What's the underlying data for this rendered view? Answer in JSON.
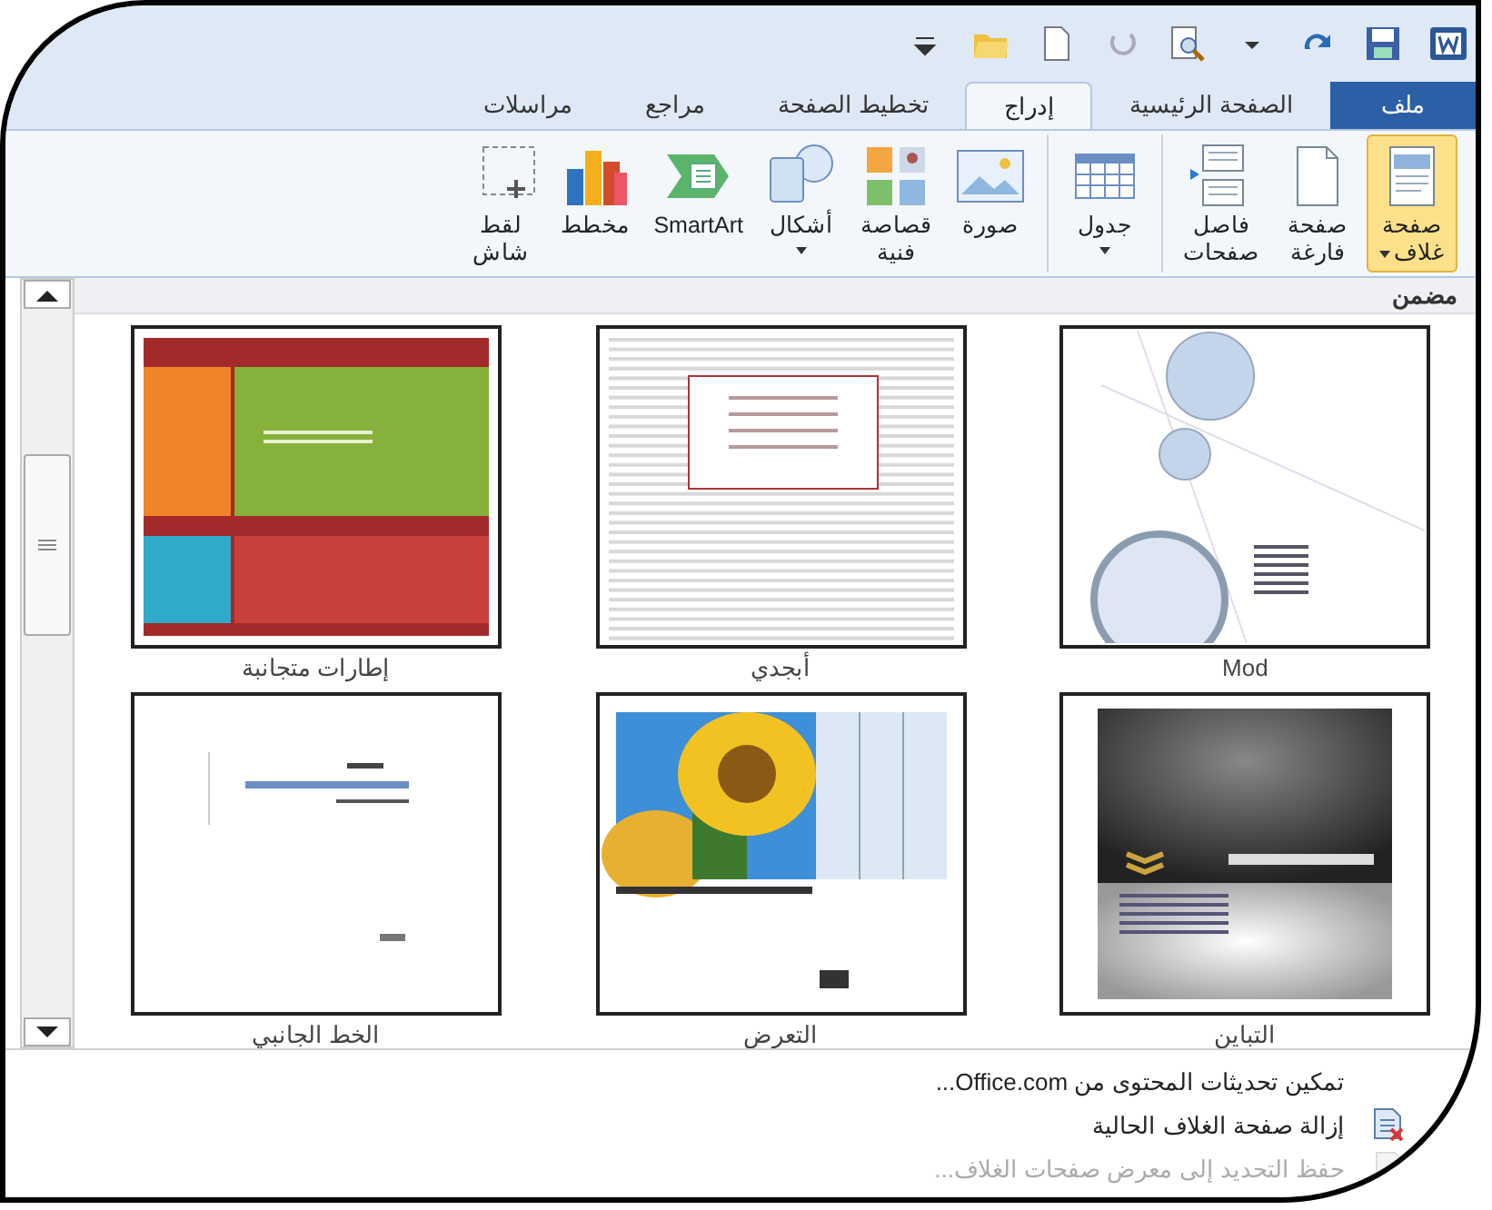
{
  "tabs": [
    {
      "label": "ملف",
      "kind": "file",
      "selected": false
    },
    {
      "label": "الصفحة الرئيسية",
      "kind": "tab",
      "selected": false
    },
    {
      "label": "إدراج",
      "kind": "tab",
      "selected": true
    },
    {
      "label": "تخطيط الصفحة",
      "kind": "tab",
      "selected": false
    },
    {
      "label": "مراجع",
      "kind": "tab",
      "selected": false
    },
    {
      "label": "مراسلات",
      "kind": "tab",
      "selected": false
    }
  ],
  "ribbon_groups": [
    [
      {
        "kind": "cover",
        "lines": [
          "صفحة",
          "غلاف"
        ],
        "dropdown": true,
        "active": true
      },
      {
        "kind": "blank",
        "lines": [
          "صفحة",
          "فارغة"
        ],
        "dropdown": false,
        "active": false
      },
      {
        "kind": "break",
        "lines": [
          "فاصل",
          "صفحات"
        ],
        "dropdown": false,
        "active": false
      }
    ],
    [
      {
        "kind": "table",
        "lines": [
          "جدول"
        ],
        "dropdown": true,
        "active": false
      }
    ],
    [
      {
        "kind": "picture",
        "lines": [
          "صورة"
        ],
        "dropdown": false,
        "active": false
      },
      {
        "kind": "clipart",
        "lines": [
          "قصاصة",
          "فنية"
        ],
        "dropdown": false,
        "active": false
      },
      {
        "kind": "shapes",
        "lines": [
          "أشكال"
        ],
        "dropdown": true,
        "active": false
      },
      {
        "kind": "smartart",
        "lines": [
          "SmartArt"
        ],
        "dropdown": false,
        "active": false
      },
      {
        "kind": "chart",
        "lines": [
          "مخطط"
        ],
        "dropdown": false,
        "active": false
      },
      {
        "kind": "screenshot",
        "lines": [
          "لقط",
          "شاش"
        ],
        "dropdown": false,
        "active": false
      }
    ]
  ],
  "gallery": {
    "section": "مضمن",
    "templates": [
      {
        "label": "Mod",
        "kind": "mod"
      },
      {
        "label": "أبجدي",
        "kind": "alphabet"
      },
      {
        "label": "إطارات متجانبة",
        "kind": "frames"
      },
      {
        "label": "التباين",
        "kind": "contrast"
      },
      {
        "label": "التعرض",
        "kind": "exposition"
      },
      {
        "label": "الخط الجانبي",
        "kind": "sideline"
      }
    ]
  },
  "menu_items": [
    {
      "label": "تمكين تحديثات المحتوى من Office.com...",
      "kind": "plain",
      "disabled": false
    },
    {
      "label": "إزالة صفحة الغلاف الحالية",
      "kind": "remove",
      "disabled": false
    },
    {
      "label": "حفظ التحديد إلى معرض صفحات الغلاف...",
      "kind": "save",
      "disabled": true
    }
  ]
}
